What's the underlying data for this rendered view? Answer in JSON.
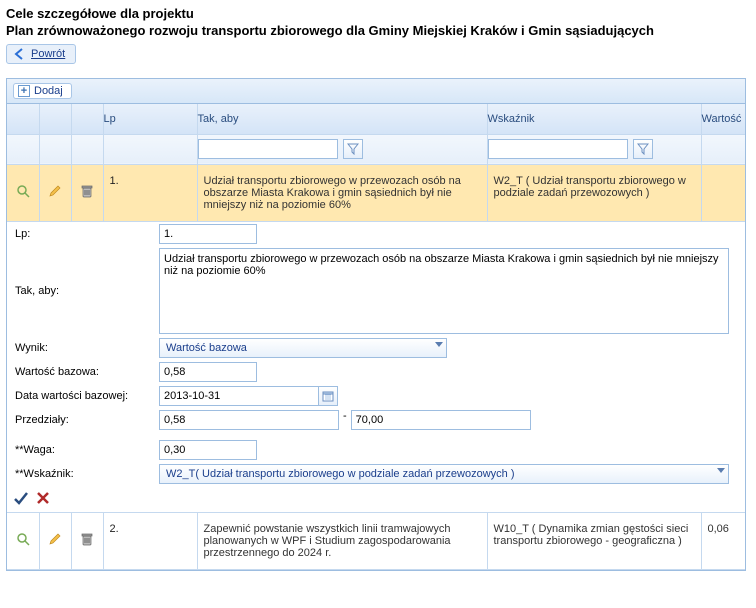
{
  "header": {
    "title": "Cele szczegółowe dla projektu",
    "subtitle": "Plan zrównoważonego rozwoju transportu zbiorowego dla Gminy Miejskiej Kraków i Gmin sąsiadujących",
    "back": "Powrót"
  },
  "toolbar": {
    "add": "Dodaj"
  },
  "columns": {
    "lp": "Lp",
    "tak_aby": "Tak, aby",
    "wskaznik": "Wskaźnik",
    "wartosc": "Wartość"
  },
  "rows": [
    {
      "lp": "1.",
      "tak_aby": "Udział transportu zbiorowego w przewozach osób na obszarze Miasta Krakowa i gmin sąsiednich był nie mniejszy niż na poziomie 60%",
      "wskaznik": "W2_T ( Udział transportu zbiorowego w podziale zadań przewozowych )",
      "wartosc": ""
    },
    {
      "lp": "2.",
      "tak_aby": "Zapewnić powstanie wszystkich linii tramwajowych planowanych w WPF i Studium zagospodarowania przestrzennego do 2024 r.",
      "wskaznik": "W10_T ( Dynamika zmian gęstości sieci transportu zbiorowego - geograficzna )",
      "wartosc": "0,06"
    }
  ],
  "detail": {
    "labels": {
      "lp": "Lp:",
      "tak_aby": "Tak, aby:",
      "wynik": "Wynik:",
      "wartosc_bazowa": "Wartość bazowa:",
      "data_wb": "Data wartości bazowej:",
      "przedzialy": "Przedziały:",
      "waga": "**Waga:",
      "wskaznik": "**Wskaźnik:"
    },
    "values": {
      "lp": "1.",
      "tak_aby": "Udział transportu zbiorowego w przewozach osób na obszarze Miasta Krakowa i gmin sąsiednich był nie mniejszy niż na poziomie 60%",
      "wynik": "Wartość bazowa",
      "wartosc_bazowa": "0,58",
      "data_wb": "2013-10-31",
      "przedzial_min": "0,58",
      "przedzial_max": "70,00",
      "waga": "0,30",
      "wskaznik": "W2_T( Udział transportu zbiorowego w podziale zadań przewozowych  )"
    }
  },
  "icons": {
    "view": "search-icon",
    "edit": "pencil-icon",
    "delete": "trash-icon"
  }
}
